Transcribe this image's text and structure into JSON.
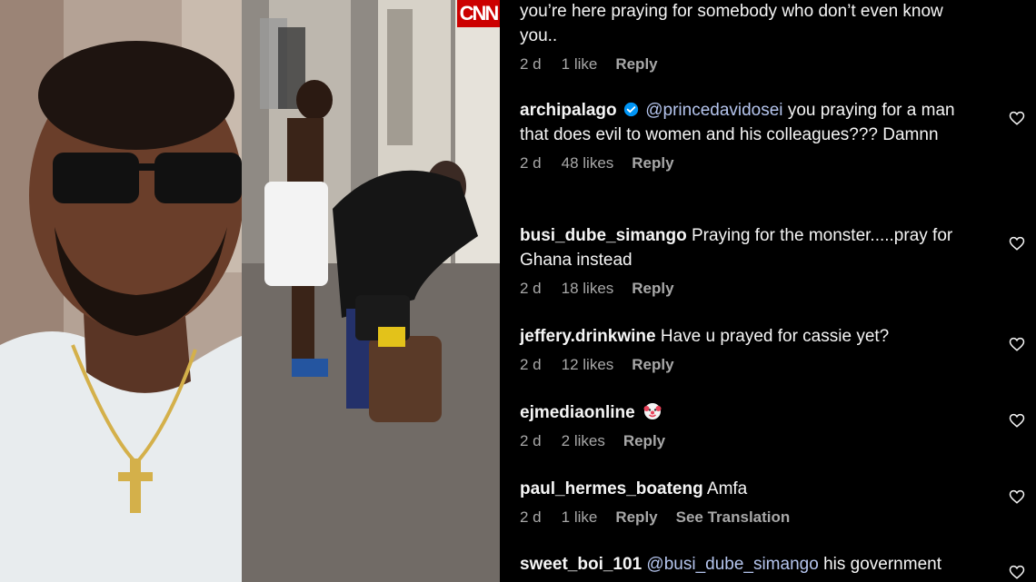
{
  "left_photo": {
    "alt": "man wearing sunglasses"
  },
  "middle_video": {
    "network_logo": "CNN"
  },
  "comments": [
    {
      "username": "",
      "text": "you’re here praying for somebody who don’t even know you..",
      "time": "2 d",
      "likes": "1 like",
      "reply": "Reply"
    },
    {
      "username": "archipalago",
      "verified": true,
      "mention": "@princedavidosei",
      "text": "you praying for a man that does evil to women and his colleagues??? Damnn",
      "time": "2 d",
      "likes": "48 likes",
      "reply": "Reply"
    },
    {
      "username": "busi_dube_simango",
      "text": "Praying for the monster.....pray for Ghana instead",
      "time": "2 d",
      "likes": "18 likes",
      "reply": "Reply"
    },
    {
      "username": "jeffery.drinkwine",
      "text": "Have u prayed for cassie yet?",
      "time": "2 d",
      "likes": "12 likes",
      "reply": "Reply"
    },
    {
      "username": "ejmediaonline",
      "emoji": "clown-face",
      "text": "",
      "time": "2 d",
      "likes": "2 likes",
      "reply": "Reply"
    },
    {
      "username": "paul_hermes_boateng",
      "text": "Amfa",
      "time": "2 d",
      "likes": "1 like",
      "reply": "Reply",
      "see_translation": "See Translation"
    },
    {
      "username": "sweet_boi_101",
      "mention": "@busi_dube_simango",
      "text": "his government"
    }
  ],
  "colors": {
    "background": "#000000",
    "meta": "#a8a8a8",
    "mention": "#b5c5ee",
    "verified": "#0095f6"
  }
}
